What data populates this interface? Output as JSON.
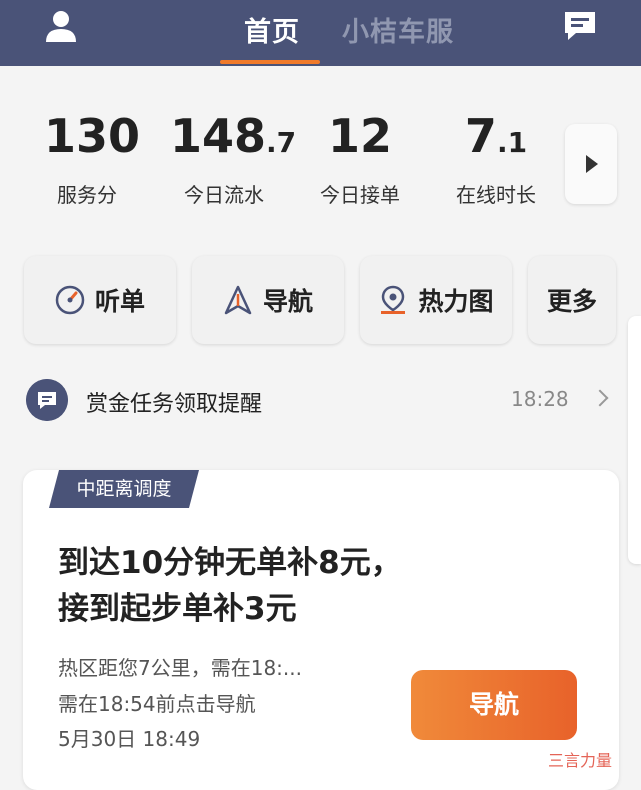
{
  "header": {
    "tabs": [
      {
        "label": "首页",
        "active": true
      },
      {
        "label": "小桔车服",
        "active": false
      }
    ],
    "user_icon": "user-icon",
    "message_icon": "message-icon",
    "active_color": "#f07a2a",
    "bg_color": "#4a5378"
  },
  "stats": [
    {
      "value": "130",
      "decimal": "",
      "label": "服务分"
    },
    {
      "value": "148",
      "decimal": ".7",
      "label": "今日流水"
    },
    {
      "value": "12",
      "decimal": "",
      "label": "今日接单"
    },
    {
      "value": "7",
      "decimal": ".1",
      "label": "在线时长"
    }
  ],
  "actions": [
    {
      "label": "听单",
      "icon": "dial-icon"
    },
    {
      "label": "导航",
      "icon": "navigation-arrow-icon"
    },
    {
      "label": "热力图",
      "icon": "location-pin-icon"
    },
    {
      "label": "更多",
      "icon": ""
    }
  ],
  "notice": {
    "text": "赏金任务领取提醒",
    "time": "18:28",
    "icon": "chat-bubble-icon"
  },
  "card": {
    "tag": "中距离调度",
    "title_line1": "到达10分钟无单补8元，",
    "title_line2": "接到起步单补3元",
    "line1": "热区距您7公里，需在18:...",
    "line2": "需在18:54前点击导航",
    "line3": "5月30日 18:49",
    "button": "导航",
    "button_color": "#e8622a"
  },
  "watermark": "三言力量"
}
